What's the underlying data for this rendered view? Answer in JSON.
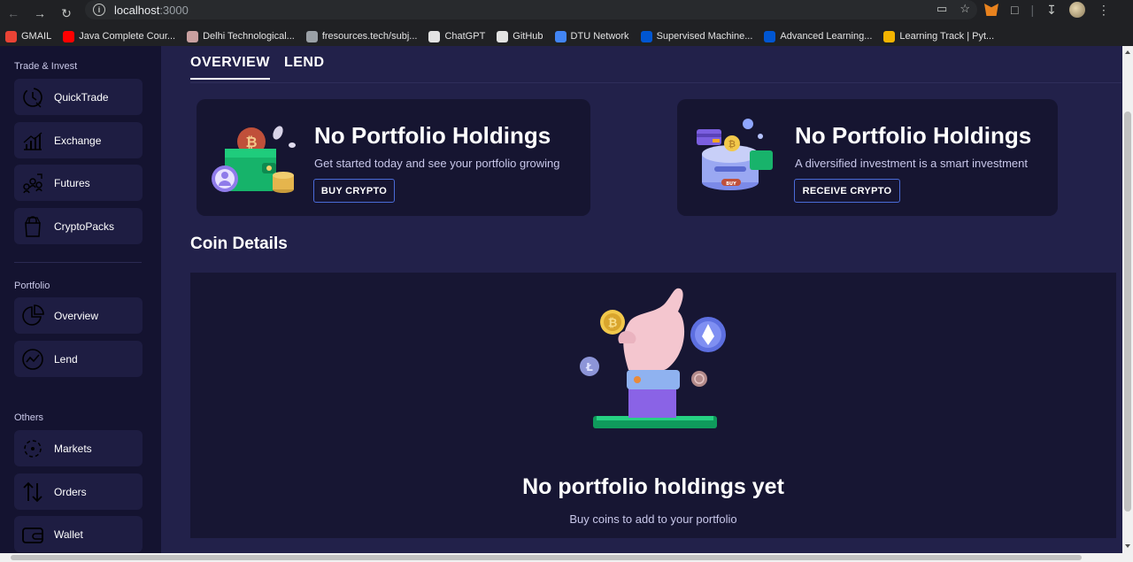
{
  "browser": {
    "url_host": "localhost",
    "url_port": ":3000",
    "bookmarks": [
      {
        "label": "GMAIL",
        "icon": "gmail-icon",
        "color": "#ea4335"
      },
      {
        "label": "Java Complete Cour...",
        "icon": "youtube-icon",
        "color": "#ff0000"
      },
      {
        "label": "Delhi Technological...",
        "icon": "dtu-icon",
        "color": "#c9a0a0"
      },
      {
        "label": "fresources.tech/subj...",
        "icon": "fresources-icon",
        "color": "#9aa0a6"
      },
      {
        "label": "ChatGPT",
        "icon": "chatgpt-icon",
        "color": "#e3e3e3"
      },
      {
        "label": "GitHub",
        "icon": "github-icon",
        "color": "#e3e3e3"
      },
      {
        "label": "DTU Network",
        "icon": "google-icon",
        "color": "#4285f4"
      },
      {
        "label": "Supervised Machine...",
        "icon": "coursera-icon",
        "color": "#0056d2"
      },
      {
        "label": "Advanced Learning...",
        "icon": "coursera-icon",
        "color": "#0056d2"
      },
      {
        "label": "Learning Track | Pyt...",
        "icon": "chart-icon",
        "color": "#f4b400"
      }
    ]
  },
  "sidebar": {
    "sections": [
      {
        "title": "Trade & Invest",
        "items": [
          {
            "label": "QuickTrade",
            "icon": "quicktrade-icon"
          },
          {
            "label": "Exchange",
            "icon": "exchange-icon"
          },
          {
            "label": "Futures",
            "icon": "futures-icon"
          },
          {
            "label": "CryptoPacks",
            "icon": "cryptopacks-icon"
          }
        ]
      },
      {
        "title": "Portfolio",
        "items": [
          {
            "label": "Overview",
            "icon": "pie-chart-icon"
          },
          {
            "label": "Lend",
            "icon": "lend-icon"
          }
        ]
      },
      {
        "title": "Others",
        "items": [
          {
            "label": "Markets",
            "icon": "markets-icon"
          },
          {
            "label": "Orders",
            "icon": "orders-icon"
          },
          {
            "label": "Wallet",
            "icon": "wallet-icon"
          }
        ]
      }
    ]
  },
  "main": {
    "tabs": [
      {
        "label": "OVERVIEW",
        "active": true
      },
      {
        "label": "LEND",
        "active": false
      }
    ],
    "cards": [
      {
        "title": "No Portfolio Holdings",
        "subtitle": "Get started today and see your portfolio growing",
        "button": "BUY CRYPTO"
      },
      {
        "title": "No Portfolio Holdings",
        "subtitle": "A diversified investment is a smart investment",
        "button": "RECEIVE CRYPTO"
      }
    ],
    "coin_details": {
      "title": "Coin Details",
      "empty_title": "No portfolio holdings yet",
      "empty_subtitle": "Buy coins to add to your portfolio"
    }
  },
  "colors": {
    "sidebar_bg": "#141330",
    "main_bg": "#22214a",
    "card_bg": "#161531",
    "button_border": "#4a6bd8"
  }
}
